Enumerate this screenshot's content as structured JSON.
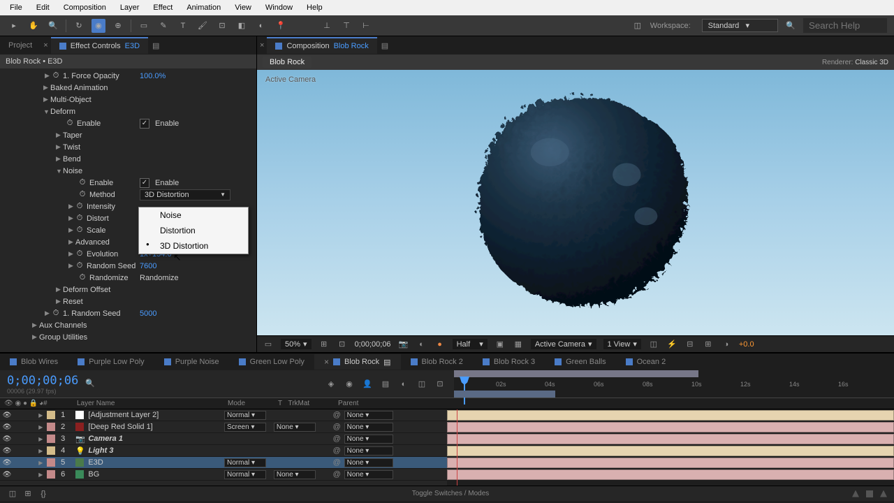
{
  "menubar": [
    "File",
    "Edit",
    "Composition",
    "Layer",
    "Effect",
    "Animation",
    "View",
    "Window",
    "Help"
  ],
  "toolbar": {
    "workspace_label": "Workspace:",
    "workspace_value": "Standard",
    "search_placeholder": "Search Help"
  },
  "project_tab": "Project",
  "effect_controls_tab": "Effect Controls",
  "effect_controls_suffix": "E3D",
  "panel_header": "Blob Rock • E3D",
  "effect_tree": {
    "force_opacity": {
      "label": "1. Force Opacity",
      "value": "100.0%"
    },
    "baked_animation": "Baked Animation",
    "multi_object": "Multi-Object",
    "deform": "Deform",
    "enable": "Enable",
    "enable_label": "Enable",
    "taper": "Taper",
    "twist": "Twist",
    "bend": "Bend",
    "noise": "Noise",
    "method": "Method",
    "method_value": "3D Distortion",
    "intensity": "Intensity",
    "distort": "Distort",
    "scale": "Scale",
    "advanced": "Advanced",
    "evolution": {
      "label": "Evolution",
      "value": "1x+154.0"
    },
    "random_seed": {
      "label": "Random Seed",
      "value": "7600"
    },
    "randomize": "Randomize",
    "randomize_btn": "Randomize",
    "deform_offset": "Deform Offset",
    "reset": "Reset",
    "one_random_seed": {
      "label": "1. Random Seed",
      "value": "5000"
    },
    "aux_channels": "Aux Channels",
    "group_utilities": "Group Utilities"
  },
  "dropdown_options": [
    "Noise",
    "Distortion",
    "3D Distortion"
  ],
  "dropdown_selected": "3D Distortion",
  "composition_tab": "Composition",
  "composition_name": "Blob Rock",
  "comp_badge": "Blob Rock",
  "renderer_label": "Renderer:",
  "renderer_value": "Classic 3D",
  "active_camera_label": "Active Camera",
  "viewport": {
    "zoom": "50%",
    "timecode": "0;00;00;06",
    "resolution": "Half",
    "camera": "Active Camera",
    "views": "1 View",
    "exposure": "+0.0"
  },
  "timeline_tabs": [
    {
      "name": "Blob Wires"
    },
    {
      "name": "Purple Low Poly"
    },
    {
      "name": "Purple Noise"
    },
    {
      "name": "Green Low Poly"
    },
    {
      "name": "Blob Rock",
      "active": true
    },
    {
      "name": "Blob Rock 2"
    },
    {
      "name": "Blob Rock 3"
    },
    {
      "name": "Green Balls"
    },
    {
      "name": "Ocean 2"
    }
  ],
  "timeline": {
    "timecode": "0;00;00;06",
    "timecode_sub": "00006 (29.97 fps)",
    "columns": {
      "num": "#",
      "name": "Layer Name",
      "mode": "Mode",
      "t": "T",
      "trkmat": "TrkMat",
      "parent": "Parent"
    },
    "ticks": [
      "02s",
      "04s",
      "06s",
      "08s",
      "10s",
      "12s",
      "14s",
      "16s"
    ],
    "footer_switches": "Toggle Switches / Modes"
  },
  "layers": [
    {
      "idx": "1",
      "color": "#d4bc8a",
      "name": "[Adjustment Layer 2]",
      "icon": "#fff",
      "mode": "Normal",
      "trkmat": "",
      "parent": "None",
      "track_color": "#e6d4b0"
    },
    {
      "idx": "2",
      "color": "#c48a8a",
      "name": "[Deep Red Solid 1]",
      "icon": "#8b2020",
      "mode": "Screen",
      "trkmat": "None",
      "parent": "None",
      "track_color": "#d9b0b0"
    },
    {
      "idx": "3",
      "color": "#c48a8a",
      "name": "Camera 1",
      "icon": "camera",
      "mode": "",
      "trkmat": "",
      "parent": "None",
      "track_color": "#d9b0b0"
    },
    {
      "idx": "4",
      "color": "#d4bc8a",
      "name": "Light 3",
      "icon": "light",
      "mode": "",
      "trkmat": "",
      "parent": "None",
      "track_color": "#e6d4b0"
    },
    {
      "idx": "5",
      "color": "#c48a8a",
      "name": "E3D",
      "icon": "#4a7a4a",
      "mode": "Normal",
      "trkmat": "",
      "parent": "None",
      "track_color": "#d9b0b0",
      "selected": true
    },
    {
      "idx": "6",
      "color": "#c48a8a",
      "name": "BG",
      "icon": "#3a8a5a",
      "mode": "Normal",
      "trkmat": "None",
      "parent": "None",
      "track_color": "#d9b0b0"
    }
  ]
}
